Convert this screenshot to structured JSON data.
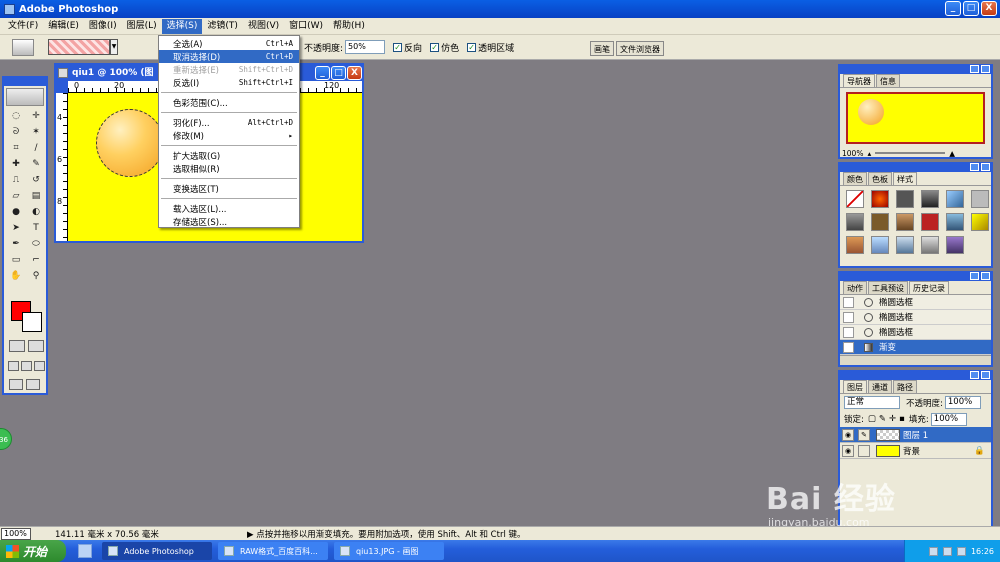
{
  "app": {
    "title": "Adobe Photoshop"
  },
  "window_buttons": {
    "minimize": "_",
    "maximize": "□",
    "close": "X"
  },
  "menubar": [
    "文件(F)",
    "编辑(E)",
    "图像(I)",
    "图层(L)",
    "选择(S)",
    "滤镜(T)",
    "视图(V)",
    "窗口(W)",
    "帮助(H)"
  ],
  "options": {
    "opacity_label": "不透明度:",
    "opacity_value": "50%",
    "reverse_label": "反向",
    "dither_label": "仿色",
    "transparency_label": "透明区域",
    "palette_well": [
      "画笔",
      "文件浏览器"
    ]
  },
  "document": {
    "title": "qiu1 @ 100% (图",
    "ruler_top": [
      "0",
      "20",
      "120"
    ],
    "ruler_left": [
      "4",
      "6",
      "8"
    ]
  },
  "select_menu": [
    {
      "label": "全选(A)",
      "shortcut": "Ctrl+A",
      "state": "normal"
    },
    {
      "label": "取消选择(D)",
      "shortcut": "Ctrl+D",
      "state": "highlight"
    },
    {
      "label": "重新选择(E)",
      "shortcut": "Shift+Ctrl+D",
      "state": "disabled"
    },
    {
      "label": "反选(I)",
      "shortcut": "Shift+Ctrl+I",
      "state": "normal"
    },
    {
      "sep": true
    },
    {
      "label": "色彩范围(C)...",
      "shortcut": "",
      "state": "normal"
    },
    {
      "sep": true
    },
    {
      "label": "羽化(F)...",
      "shortcut": "Alt+Ctrl+D",
      "state": "normal"
    },
    {
      "label": "修改(M)",
      "shortcut": "▸",
      "state": "normal"
    },
    {
      "sep": true
    },
    {
      "label": "扩大选取(G)",
      "shortcut": "",
      "state": "normal"
    },
    {
      "label": "选取相似(R)",
      "shortcut": "",
      "state": "normal"
    },
    {
      "sep": true
    },
    {
      "label": "变换选区(T)",
      "shortcut": "",
      "state": "normal"
    },
    {
      "sep": true
    },
    {
      "label": "载入选区(L)...",
      "shortcut": "",
      "state": "normal"
    },
    {
      "label": "存储选区(S)...",
      "shortcut": "",
      "state": "normal"
    }
  ],
  "navigator": {
    "tabs": [
      "导航器",
      "信息"
    ],
    "zoom": "100%"
  },
  "swatches": {
    "tabs": [
      "颜色",
      "色板",
      "样式"
    ]
  },
  "history": {
    "tabs": [
      "动作",
      "工具预设",
      "历史记录"
    ],
    "rows": [
      {
        "label": "椭圆选框",
        "selected": false
      },
      {
        "label": "椭圆选框",
        "selected": false
      },
      {
        "label": "椭圆选框",
        "selected": false
      },
      {
        "label": "渐变",
        "selected": true
      }
    ]
  },
  "layers": {
    "tabs": [
      "图层",
      "通道",
      "路径"
    ],
    "blend_mode": "正常",
    "opacity_label": "不透明度:",
    "opacity_value": "100%",
    "lock_label": "锁定:",
    "fill_label": "填充:",
    "fill_value": "100%",
    "rows": [
      {
        "label": "图层 1",
        "selected": true,
        "thumb": "#e8e8e8"
      },
      {
        "label": "背景",
        "selected": false,
        "thumb": "#ffff00"
      }
    ]
  },
  "status": {
    "zoom": "100%",
    "dimensions": "141.11 毫米 x 70.56 毫米",
    "hint": "▶ 点按并拖移以用渐变填充。要用附加选项，使用 Shift、Alt 和 Ctrl 键。"
  },
  "taskbar": {
    "start": "开始",
    "tasks": [
      {
        "label": "Adobe Photoshop",
        "active": true
      },
      {
        "label": "RAW格式_百度百科...",
        "active": false
      },
      {
        "label": "qiu13.JPG - 画图",
        "active": false
      }
    ],
    "clock": "16:26"
  },
  "side_badge": "36",
  "watermark": {
    "main": "Bai 经验",
    "sub": "jingyan.baidu.com"
  },
  "colors": {
    "accent": "#2a5bd8",
    "foreground": "#ff0000",
    "background": "#ffffff",
    "canvas": "#ffff00"
  }
}
